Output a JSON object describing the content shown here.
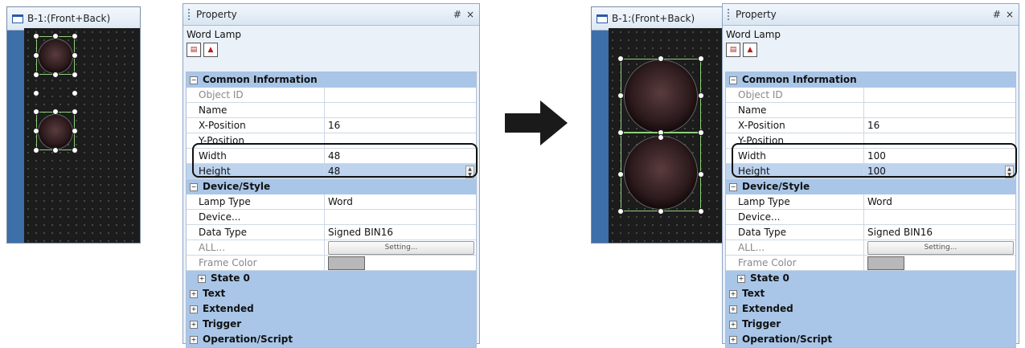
{
  "arrow_icon": "right-arrow-icon",
  "before": {
    "editor": {
      "title": "B-1:(Front+Back)"
    },
    "property": {
      "title": "Property",
      "pin_glyph": "#",
      "close_glyph": "×",
      "object_name": "Word Lamp",
      "common_information": "Common Information",
      "object_id_label": "Object ID",
      "name_label": "Name",
      "x_position_label": "X-Position",
      "x_position_value": "16",
      "y_position_label": "Y-Position",
      "width_label": "Width",
      "width_value": "48",
      "height_label": "Height",
      "height_value": "48",
      "device_style": "Device/Style",
      "lamp_type_label": "Lamp Type",
      "lamp_type_value": "Word",
      "device_label": "Device...",
      "data_type_label": "Data Type",
      "data_type_value": "Signed BIN16",
      "all_label": "ALL...",
      "setting_label": "Setting...",
      "frame_color_label": "Frame Color",
      "frame_color_value": "#b8b8b8",
      "state0": "State 0",
      "text": "Text",
      "extended": "Extended",
      "trigger": "Trigger",
      "operation_script": "Operation/Script"
    }
  },
  "after": {
    "editor": {
      "title": "B-1:(Front+Back)"
    },
    "property": {
      "title": "Property",
      "pin_glyph": "#",
      "close_glyph": "×",
      "object_name": "Word Lamp",
      "common_information": "Common Information",
      "object_id_label": "Object ID",
      "name_label": "Name",
      "x_position_label": "X-Position",
      "x_position_value": "16",
      "y_position_label": "Y-Position",
      "width_label": "Width",
      "width_value": "100",
      "height_label": "Height",
      "height_value": "100",
      "device_style": "Device/Style",
      "lamp_type_label": "Lamp Type",
      "lamp_type_value": "Word",
      "device_label": "Device...",
      "data_type_label": "Data Type",
      "data_type_value": "Signed BIN16",
      "all_label": "ALL...",
      "setting_label": "Setting...",
      "frame_color_label": "Frame Color",
      "frame_color_value": "#b8b8b8",
      "state0": "State 0",
      "text": "Text",
      "extended": "Extended",
      "trigger": "Trigger",
      "operation_script": "Operation/Script"
    }
  }
}
